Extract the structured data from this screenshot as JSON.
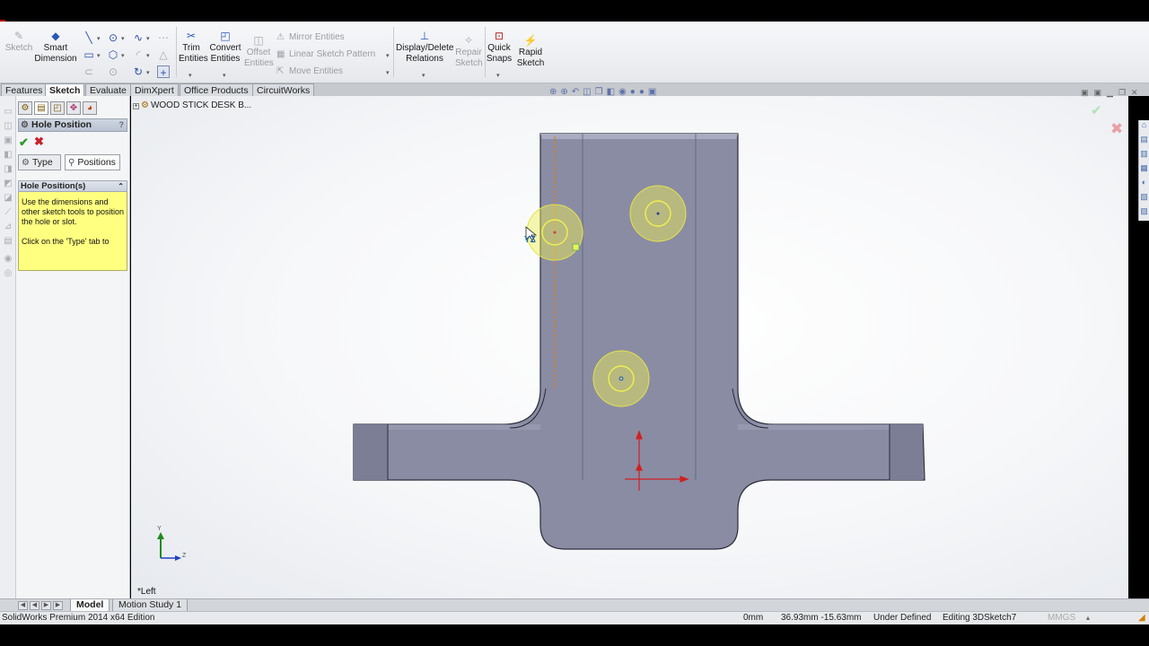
{
  "ribbon": {
    "sketch": "Sketch",
    "smart_dimension": [
      "Smart",
      "Dimension"
    ],
    "trim_entities": [
      "Trim",
      "Entities"
    ],
    "convert_entities": [
      "Convert",
      "Entities"
    ],
    "offset_entities": [
      "Offset",
      "Entities"
    ],
    "mirror_entities": "Mirror Entities",
    "linear_sketch_pattern": "Linear Sketch Pattern",
    "move_entities": "Move Entities",
    "display_delete_relations": [
      "Display/Delete",
      "Relations"
    ],
    "repair_sketch": [
      "Repair",
      "Sketch"
    ],
    "quick_snaps": [
      "Quick",
      "Snaps"
    ],
    "rapid_sketch": [
      "Rapid",
      "Sketch"
    ]
  },
  "command_tabs": [
    "Features",
    "Sketch",
    "Evaluate",
    "DimXpert",
    "Office Products",
    "CircuitWorks"
  ],
  "active_command_tab": "Sketch",
  "property_manager": {
    "title": "Hole Position",
    "help": "?",
    "tab_type": "Type",
    "tab_positions": "Positions",
    "group_title": "Hole Position(s)",
    "message_1": "Use the dimensions and other sketch tools to position the hole or slot.",
    "message_2": "Click on the 'Type' tab to"
  },
  "viewport": {
    "tree_root": "WOOD STICK DESK B...",
    "view_label": "*Left",
    "triad_y": "Y",
    "triad_z": "Z",
    "cursor_label": "YZ"
  },
  "bottom_tabs": [
    "Model",
    "Motion Study 1"
  ],
  "active_bottom_tab": "Model",
  "status": {
    "app": "SolidWorks Premium 2014 x64 Edition",
    "unit_fragment": "0mm",
    "coordinates": "36.93mm -15.63mm",
    "definition": "Under Defined",
    "editing": "Editing 3DSketch7",
    "units": "MMGS"
  },
  "colors": {
    "part_face": "#888aa0",
    "hole_highlight": "#f0f050",
    "ok_green": "#2e9b2e",
    "cancel_red": "#c8202a"
  }
}
